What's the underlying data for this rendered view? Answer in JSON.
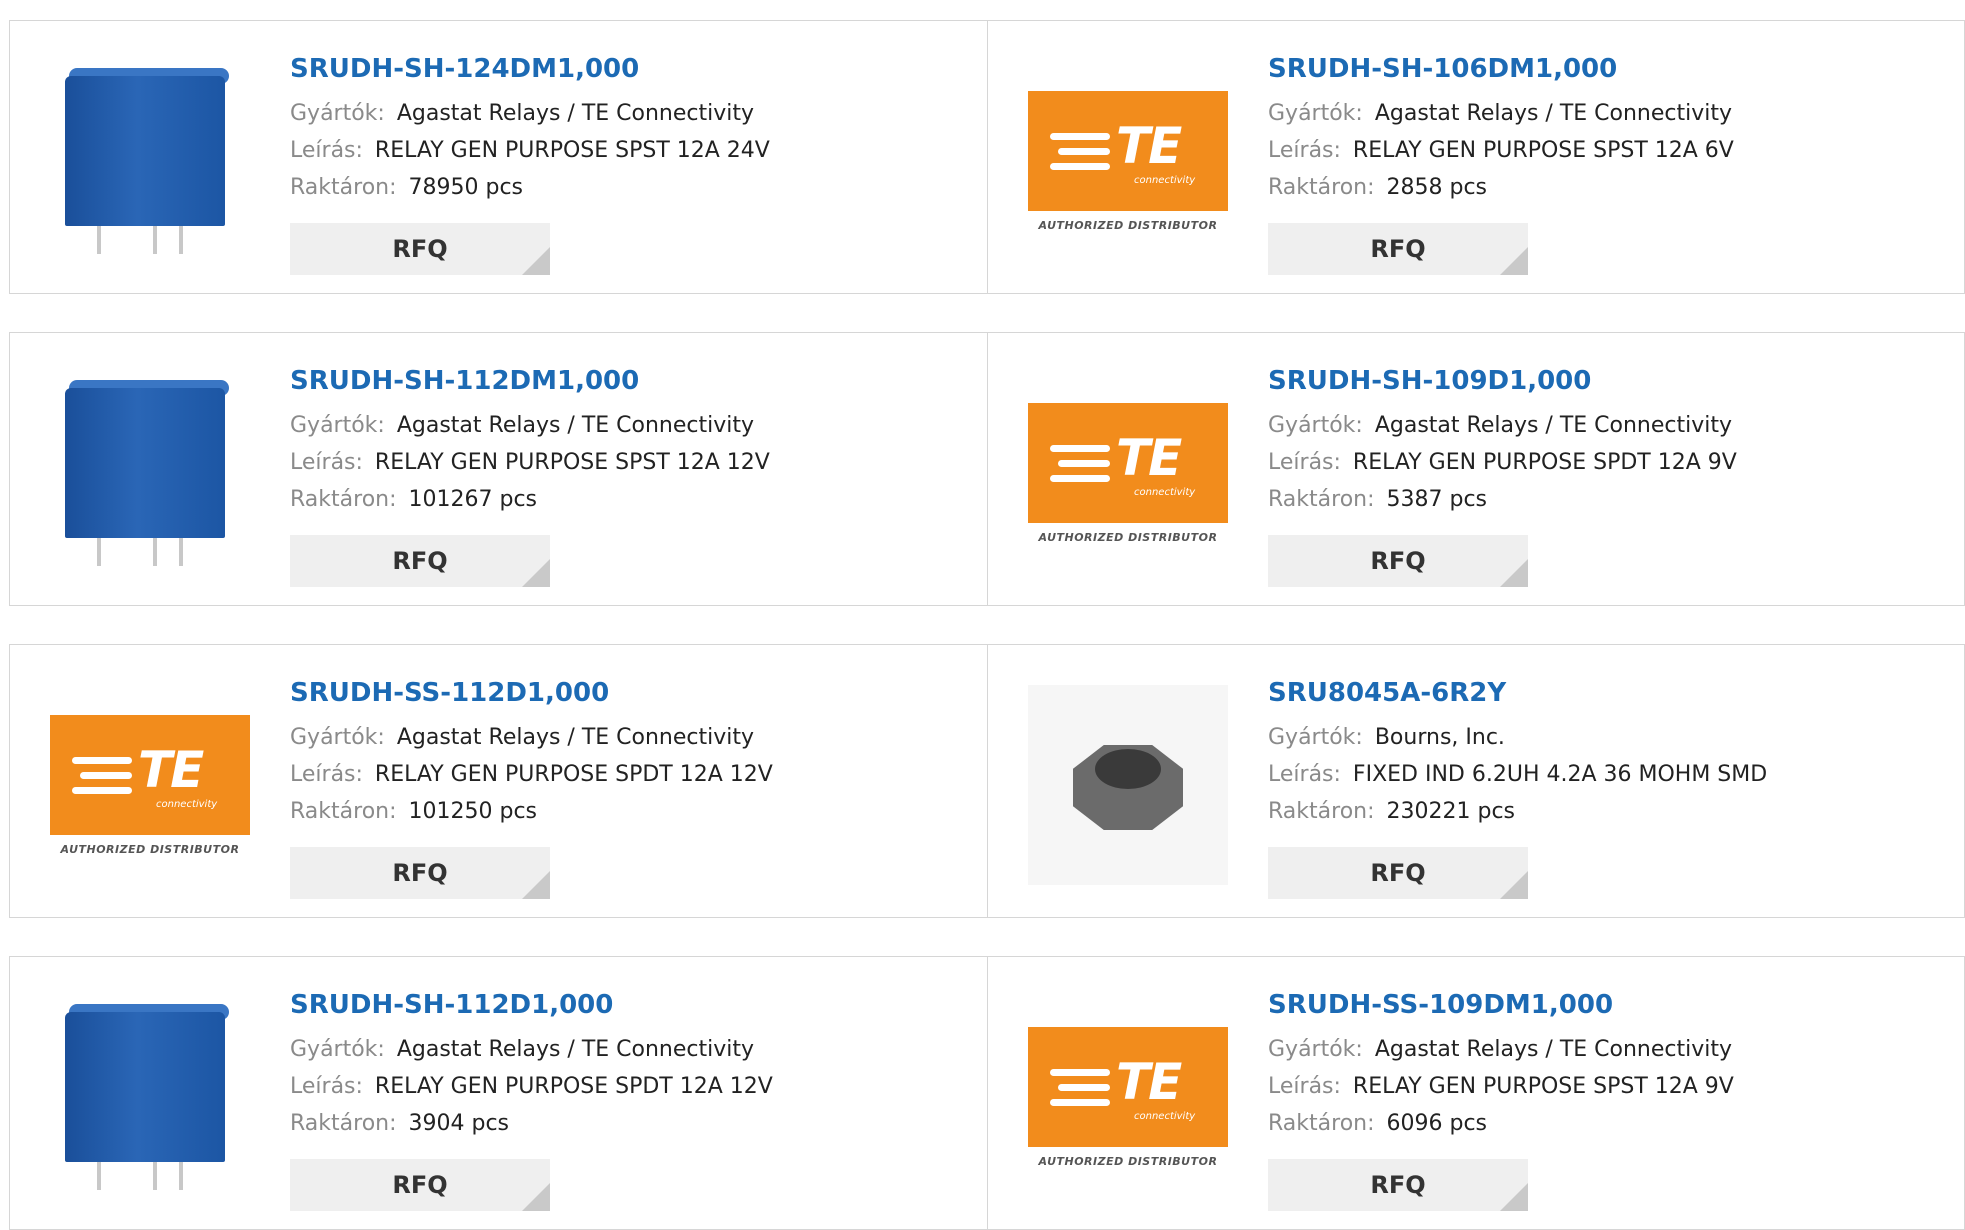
{
  "labels": {
    "manufacturer": "Gyártók:",
    "description": "Leírás:",
    "stock": "Raktáron:"
  },
  "products": [
    {
      "part": "SRUDH-SH-124DM1,000",
      "manufacturer": "Agastat Relays / TE Connectivity",
      "description": "RELAY GEN PURPOSE SPST 12A 24V",
      "stock": "78950 pcs",
      "rfq": "RFQ",
      "image": "relay-photo"
    },
    {
      "part": "SRUDH-SH-106DM1,000",
      "manufacturer": "Agastat Relays / TE Connectivity",
      "description": "RELAY GEN PURPOSE SPST 12A 6V",
      "stock": "2858 pcs",
      "rfq": "RFQ",
      "image": "te-logo",
      "logo": {
        "mark": "TE",
        "sub": "connectivity",
        "auth": "AUTHORIZED DISTRIBUTOR"
      }
    },
    {
      "part": "SRUDH-SH-112DM1,000",
      "manufacturer": "Agastat Relays / TE Connectivity",
      "description": "RELAY GEN PURPOSE SPST 12A 12V",
      "stock": "101267 pcs",
      "rfq": "RFQ",
      "image": "relay-photo"
    },
    {
      "part": "SRUDH-SH-109D1,000",
      "manufacturer": "Agastat Relays / TE Connectivity",
      "description": "RELAY GEN PURPOSE SPDT 12A 9V",
      "stock": "5387 pcs",
      "rfq": "RFQ",
      "image": "te-logo",
      "logo": {
        "mark": "TE",
        "sub": "connectivity",
        "auth": "AUTHORIZED DISTRIBUTOR"
      }
    },
    {
      "part": "SRUDH-SS-112D1,000",
      "manufacturer": "Agastat Relays / TE Connectivity",
      "description": "RELAY GEN PURPOSE SPDT 12A 12V",
      "stock": "101250 pcs",
      "rfq": "RFQ",
      "image": "te-logo",
      "logo": {
        "mark": "TE",
        "sub": "connectivity",
        "auth": "AUTHORIZED DISTRIBUTOR"
      }
    },
    {
      "part": "SRU8045A-6R2Y",
      "manufacturer": "Bourns, Inc.",
      "description": "FIXED IND 6.2UH 4.2A 36 MOHM SMD",
      "stock": "230221 pcs",
      "rfq": "RFQ",
      "image": "inductor-photo"
    },
    {
      "part": "SRUDH-SH-112D1,000",
      "manufacturer": "Agastat Relays / TE Connectivity",
      "description": "RELAY GEN PURPOSE SPDT 12A 12V",
      "stock": "3904 pcs",
      "rfq": "RFQ",
      "image": "relay-photo"
    },
    {
      "part": "SRUDH-SS-109DM1,000",
      "manufacturer": "Agastat Relays / TE Connectivity",
      "description": "RELAY GEN PURPOSE SPST 12A 9V",
      "stock": "6096 pcs",
      "rfq": "RFQ",
      "image": "te-logo",
      "logo": {
        "mark": "TE",
        "sub": "connectivity",
        "auth": "AUTHORIZED DISTRIBUTOR"
      }
    }
  ]
}
